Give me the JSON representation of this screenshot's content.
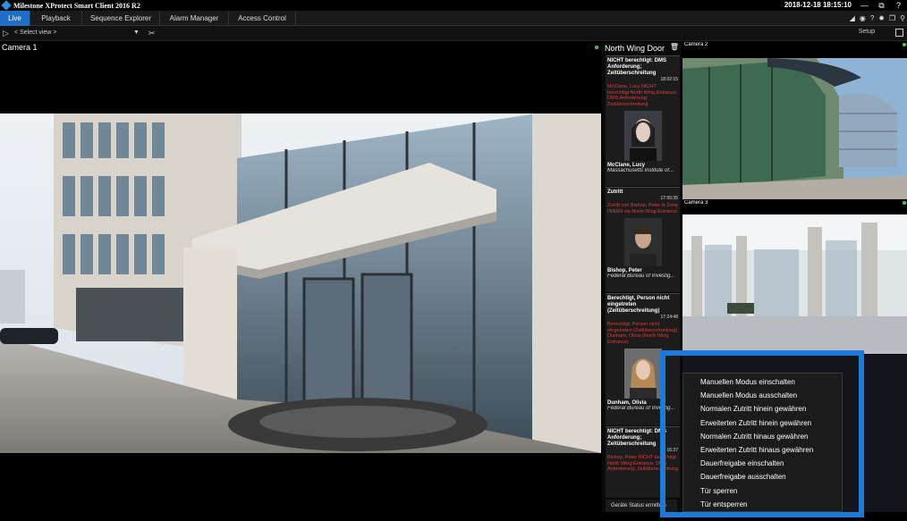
{
  "app": {
    "title": "Milestone XProtect Smart Client 2016 R2",
    "datetime": "2018-12-18 18:15:10",
    "window_controls": [
      "—",
      "⧉",
      "?"
    ]
  },
  "tabs": [
    {
      "label": "Live",
      "active": true
    },
    {
      "label": "Playback",
      "active": false
    },
    {
      "label": "Sequence Explorer",
      "active": false
    },
    {
      "label": "Alarm Manager",
      "active": false
    },
    {
      "label": "Access Control",
      "active": false
    }
  ],
  "toolbar": {
    "view_select": "< Select view >",
    "setup_label": "Setup"
  },
  "cameras": {
    "main_label": "Camera 1",
    "cam2_label": "Camera 2",
    "cam3_label": "Camera 3"
  },
  "events": {
    "title": "North Wing Door",
    "footer": "Geräte Status ermitteln",
    "cards": [
      {
        "head": "NICHT berechtigt: DMS Anforderung; Zeitüberschreitung",
        "time": "18:02:15",
        "detail": "McClane, Lucy NICHT berechtigt North Wing Entrance; DMS Anforderung; Zeitüberschreitung",
        "name": "McClane, Lucy",
        "org": "Massachusetts institute of..."
      },
      {
        "head": "Zutritt",
        "time": "17:55:35",
        "detail": "Zutritt von Bishop, Peter in Zone INNEN via North Wing Entrance",
        "name": "Bishop, Peter",
        "org": "Federal Bureau of Investig..."
      },
      {
        "head": "Berechtigt, Person nicht eingetreten (Zeitüberschreitung)",
        "time": "17:24:48",
        "detail": "Berechtigt, Person nicht eingetreten (Zeitüberschreitung) Dunham, Olivia (North Wing Entrance)",
        "name": "Dunham, Olivia",
        "org": "Federal Bureau of Investig..."
      },
      {
        "head": "NICHT berechtigt: DMS Anforderung; Zeitüberschreitung",
        "time": "16:37",
        "detail": "Bishop, Peter NICHT berechtigt North Wing Entrance; DMS Anforderung; Zeitüberschreitung",
        "name": "",
        "org": ""
      }
    ]
  },
  "context_menu": {
    "items": [
      "Manuellen Modus einschalten",
      "Manuellen Modus ausschalten",
      "Normalen Zutritt hinein gewähren",
      "Erweiterten Zutritt hinein gewähren",
      "Normalen Zutritt hinaus gewähren",
      "Erweiterten Zutritt hinaus gewähren",
      "Dauerfreigabe einschalten",
      "Dauerfreigabe ausschalten",
      "Tür sperren",
      "Tür entsperren"
    ]
  },
  "colors": {
    "accent": "#1f6fc6",
    "highlight": "#1d7ad8",
    "alert": "#e53a3a",
    "live": "#2fd24a"
  }
}
